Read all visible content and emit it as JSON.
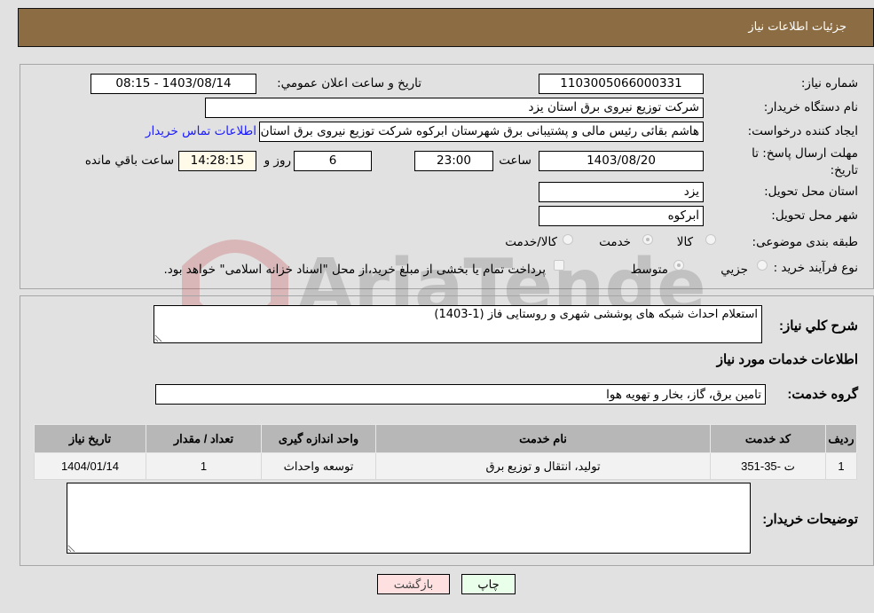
{
  "header": {
    "title": "جزئیات اطلاعات نیاز"
  },
  "form": {
    "need_number": {
      "label": "شماره نیاز:",
      "value": "1103005066000331"
    },
    "announce_datetime": {
      "label": "تاريخ و ساعت اعلان عمومي:",
      "value": "1403/08/14 - 08:15"
    },
    "buyer_org": {
      "label": "نام دستگاه خريدار:",
      "value": "شرکت توزیع نیروی برق استان یزد"
    },
    "requester": {
      "label": "ايجاد کننده درخواست:",
      "value": "هاشم  بقائی  رئیس مالی و پشتیبانی برق شهرستان ابرکوه  شرکت توزیع نیروی برق استان یزد"
    },
    "buyer_contact_link": "اطلاعات تماس خريدار",
    "deadline": {
      "label": "مهلت ارسال پاسخ: تا تاريخ:",
      "date": "1403/08/20",
      "time_label": "ساعت",
      "time": "23:00",
      "days": "6",
      "days_label": "روز و",
      "remaining": "14:28:15",
      "remaining_label": "ساعت باقي مانده"
    },
    "delivery_province": {
      "label": "استان محل تحويل:",
      "value": "یزد"
    },
    "delivery_city": {
      "label": "شهر محل تحويل:",
      "value": "ابرکوه"
    },
    "category": {
      "label": "طبقه بندی موضوعی:",
      "options": [
        "کالا",
        "خدمت",
        "کالا/خدمت"
      ],
      "selected": "خدمت"
    },
    "purchase_process": {
      "label": "نوع فرآيند خريد :",
      "options": [
        "جزيي",
        "متوسط"
      ],
      "selected": "متوسط",
      "treasury_note": "پرداخت تمام يا بخشی از مبلغ خريد،از محل \"اسناد خزانه اسلامی\" خواهد بود.",
      "treasury_checked": false
    }
  },
  "details": {
    "description_label": "شرح كلي نياز:",
    "description_value": "استعلام احداث شبکه های پوششی شهری و روستایی فاز (1-1403)",
    "services_title": "اطلاعات خدمات مورد نياز",
    "service_group_label": "گروه خدمت:",
    "service_group_value": "تامین برق، گاز، بخار و تهویه هوا",
    "table": {
      "headers": [
        "رديف",
        "کد خدمت",
        "نام خدمت",
        "واحد اندازه گيری",
        "تعداد / مقدار",
        "تاريخ نياز"
      ],
      "rows": [
        [
          "1",
          "ت -35-351",
          "تولید، انتقال و توزیع برق",
          "توسعه واحداث",
          "1",
          "1404/01/14"
        ]
      ]
    },
    "buyer_notes_label": "توضيحات خريدار:",
    "buyer_notes_value": ""
  },
  "buttons": {
    "print": "چاپ",
    "back": "بازگشت"
  },
  "watermark": {
    "text": "AriaTender.neT"
  },
  "colors": {
    "header": "#8c6c43",
    "link": "#1a1aff",
    "print_bg": "#eaffea",
    "back_bg": "#ffe0e0"
  }
}
